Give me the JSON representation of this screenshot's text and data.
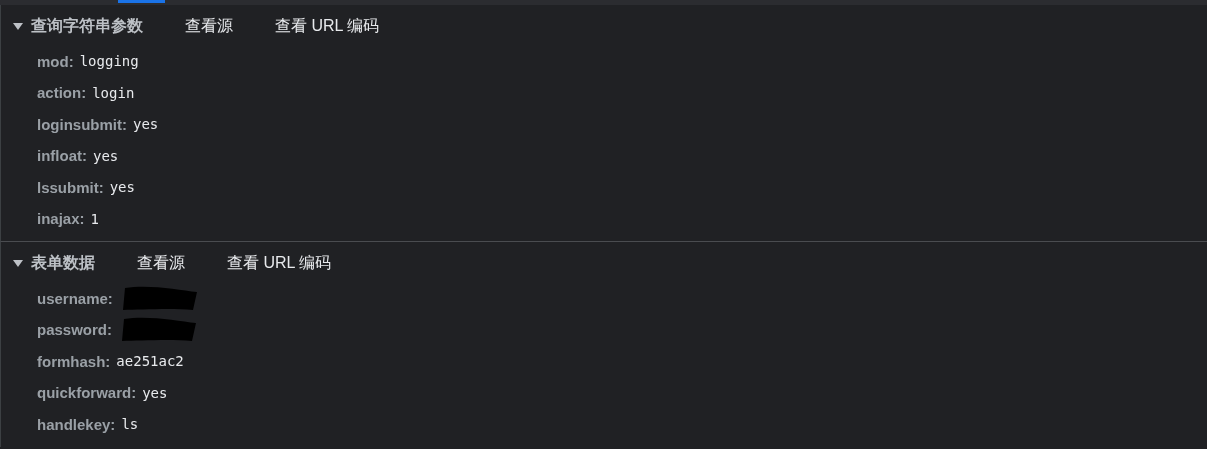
{
  "sections": [
    {
      "title": "查询字符串参数",
      "expanded": true,
      "actions": [
        "查看源",
        "查看 URL 编码"
      ],
      "rows": [
        {
          "key": "mod:",
          "value": "logging",
          "redacted": false
        },
        {
          "key": "action:",
          "value": "login",
          "redacted": false
        },
        {
          "key": "loginsubmit:",
          "value": "yes",
          "redacted": false
        },
        {
          "key": "infloat:",
          "value": "yes",
          "redacted": false
        },
        {
          "key": "lssubmit:",
          "value": "yes",
          "redacted": false
        },
        {
          "key": "inajax:",
          "value": "1",
          "redacted": false
        }
      ]
    },
    {
      "title": "表单数据",
      "expanded": true,
      "actions": [
        "查看源",
        "查看 URL 编码"
      ],
      "rows": [
        {
          "key": "username:",
          "redacted": true
        },
        {
          "key": "password:",
          "redacted": true
        },
        {
          "key": "formhash:",
          "value": "ae251ac2",
          "redacted": false
        },
        {
          "key": "quickforward:",
          "value": "yes",
          "redacted": false
        },
        {
          "key": "handlekey:",
          "value": "ls",
          "redacted": false
        }
      ]
    }
  ]
}
